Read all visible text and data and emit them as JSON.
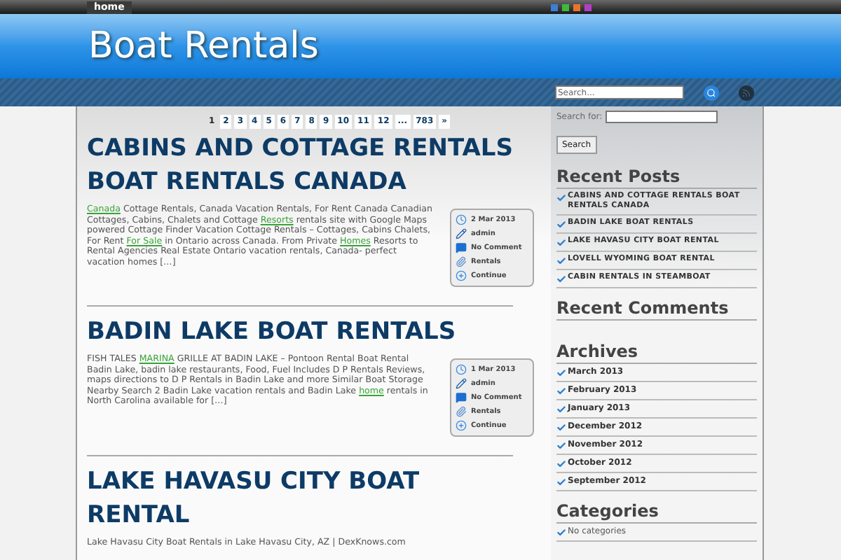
{
  "top_nav": {
    "items": [
      {
        "label": "home",
        "selected": true
      }
    ]
  },
  "color_swatches": [
    {
      "color": "#3b7fd6"
    },
    {
      "color": "#3fb93a"
    },
    {
      "color": "#e8752a"
    },
    {
      "color": "#b13fc4"
    }
  ],
  "site_title": "Boat Rentals",
  "header_search": {
    "placeholder": "Search..."
  },
  "pagination": [
    {
      "label": "1",
      "selected": true
    },
    {
      "label": "2",
      "selected": false
    },
    {
      "label": "3",
      "selected": false
    },
    {
      "label": "4",
      "selected": false
    },
    {
      "label": "5",
      "selected": false
    },
    {
      "label": "6",
      "selected": false
    },
    {
      "label": "7",
      "selected": false
    },
    {
      "label": "8",
      "selected": false
    },
    {
      "label": "9",
      "selected": false
    },
    {
      "label": "10",
      "selected": false
    },
    {
      "label": "11",
      "selected": false
    },
    {
      "label": "12",
      "selected": false
    },
    {
      "label": "...",
      "selected": false
    },
    {
      "label": "783",
      "selected": false
    },
    {
      "label": "»",
      "selected": false
    }
  ],
  "posts": [
    {
      "title": "CABINS AND COTTAGE RENTALS BOAT RENTALS CANADA",
      "excerpt": [
        {
          "text": "Canada",
          "link": true
        },
        {
          "text": " Cottage Rentals, Canada Vacation Rentals, For Rent Canada Canadian Cottages, Cabins, Chalets and Cottage ",
          "link": false
        },
        {
          "text": "Resorts",
          "link": true
        },
        {
          "text": " rentals site with Google Maps powered Cottage Finder Vacation Cottage Rentals – Cottages, Cabins Chalets, For Rent ",
          "link": false
        },
        {
          "text": "For Sale",
          "link": true
        },
        {
          "text": " in Ontario across Canada. From Private ",
          "link": false
        },
        {
          "text": "Homes",
          "link": true
        },
        {
          "text": " Resorts to Rental Agencies Real Estate Ontario vacation rentals, Canada- perfect vacation homes […]",
          "link": false
        }
      ],
      "meta": {
        "date": "2 Mar 2013",
        "author": "admin",
        "comments": "No Comment",
        "category": "Rentals",
        "more": "Continue"
      }
    },
    {
      "title": "BADIN LAKE BOAT RENTALS",
      "excerpt": [
        {
          "text": "FISH TALES ",
          "link": false
        },
        {
          "text": "MARINA",
          "link": true
        },
        {
          "text": " GRILLE AT BADIN LAKE – Pontoon Rental Boat Rental Badin Lake, badin lake restaurants, Food, Fuel Includes D P Rentals Reviews, maps directions to D P Rentals in Badin Lake and more Similar Boat Storage Nearby Search 2 Badin Lake vacation rentals and Badin Lake ",
          "link": false
        },
        {
          "text": "home",
          "link": true
        },
        {
          "text": " rentals in North Carolina available for […]",
          "link": false
        }
      ],
      "meta": {
        "date": "1 Mar 2013",
        "author": "admin",
        "comments": "No Comment",
        "category": "Rentals",
        "more": "Continue"
      }
    },
    {
      "title": "LAKE HAVASU CITY BOAT RENTAL",
      "excerpt": [
        {
          "text": "Lake Havasu City Boat Rentals in Lake Havasu City, AZ | DexKnows.com",
          "link": false
        }
      ]
    }
  ],
  "sidebar": {
    "search_label": "Search for:",
    "search_button": "Search",
    "widgets": [
      {
        "title": "Recent Posts",
        "kind": "posts",
        "items": [
          "CABINS AND COTTAGE RENTALS BOAT RENTALS CANADA",
          "BADIN LAKE BOAT RENTALS",
          "LAKE HAVASU CITY BOAT RENTAL",
          "LOVELL WYOMING BOAT RENTAL",
          "CABIN RENTALS IN STEAMBOAT"
        ]
      },
      {
        "title": "Recent Comments",
        "kind": "empty"
      },
      {
        "title": "Archives",
        "kind": "archives",
        "items": [
          "March 2013",
          "February 2013",
          "January 2013",
          "December 2012",
          "November 2012",
          "October 2012",
          "September 2012"
        ]
      },
      {
        "title": "Categories",
        "kind": "plain",
        "items": [
          "No categories"
        ]
      }
    ]
  }
}
